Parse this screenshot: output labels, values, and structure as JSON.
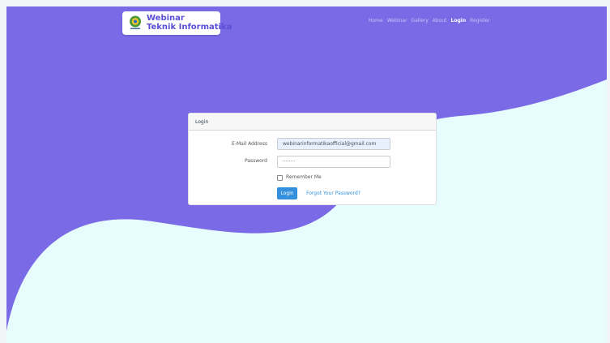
{
  "brand": {
    "line1": "Webinar",
    "line2": "Teknik Informatika",
    "emblem_icon": "university-emblem-icon"
  },
  "nav": {
    "items": [
      {
        "label": "Home"
      },
      {
        "label": "Webinar"
      },
      {
        "label": "Gallery"
      },
      {
        "label": "About"
      },
      {
        "label": "Login"
      },
      {
        "label": "Register"
      }
    ],
    "active": "Login"
  },
  "login_card": {
    "header": "Login",
    "email_label": "E-Mail Address",
    "email_value": "webinarinformatikaofficial@gmail.com",
    "password_label": "Password",
    "password_value": "········",
    "remember_label": "Remember Me",
    "remember_checked": false,
    "login_button": "Login",
    "forgot_link": "Forgot Your Password?"
  },
  "colors": {
    "background_purple": "#7b6ae6",
    "wave_light": "#e6fcfd",
    "button_blue": "#3490dc",
    "link_blue": "#3490dc"
  }
}
